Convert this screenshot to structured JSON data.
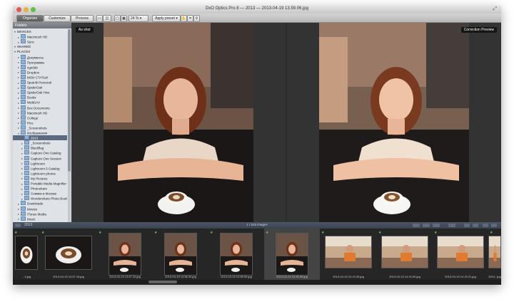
{
  "window": {
    "title": "DxO Optics Pro 8 — 2013 — 2013-04-19 13.59.06.jpg",
    "fullscreen_icon": "expand-icon"
  },
  "toolbar": {
    "tabs": [
      {
        "label": "Organize",
        "active": true
      },
      {
        "label": "Customize",
        "active": false
      },
      {
        "label": "Process",
        "active": false
      }
    ],
    "zoom_value": "24 %",
    "apply_preset_label": "Apply preset",
    "tools": [
      "hand-icon",
      "crop-icon",
      "zoom-icon"
    ]
  },
  "sidebar": {
    "header": "Folders",
    "rows": [
      {
        "label": "DEVICES",
        "type": "section"
      },
      {
        "label": "Macintosh HD",
        "type": "folder",
        "indent": 1
      },
      {
        "label": "Sync",
        "type": "folder",
        "indent": 1
      },
      {
        "label": "SHARED",
        "type": "section"
      },
      {
        "label": "PLACES",
        "type": "section"
      },
      {
        "label": "Документы",
        "type": "folder",
        "indent": 1
      },
      {
        "label": "Программы",
        "type": "folder",
        "indent": 1
      },
      {
        "label": "cgedub",
        "type": "folder",
        "indent": 1
      },
      {
        "label": "Dropbox",
        "type": "folder",
        "indent": 1
      },
      {
        "label": "МОИ СТАТЬИ",
        "type": "folder",
        "indent": 1
      },
      {
        "label": "Sputnik Personal",
        "type": "folder",
        "indent": 1
      },
      {
        "label": "SpiderOak",
        "type": "folder",
        "indent": 1
      },
      {
        "label": "SpiderOak Hive",
        "type": "folder",
        "indent": 1
      },
      {
        "label": "Books",
        "type": "folder",
        "indent": 1
      },
      {
        "label": "WebDAV",
        "type": "folder",
        "indent": 1
      },
      {
        "label": "Box Documents",
        "type": "folder",
        "indent": 1
      },
      {
        "label": "Macintosh HD",
        "type": "folder",
        "indent": 1
      },
      {
        "label": "College",
        "type": "folder",
        "indent": 1
      },
      {
        "label": "Pics",
        "type": "folder",
        "indent": 1
      },
      {
        "label": "_Screenshots",
        "type": "folder",
        "indent": 1
      },
      {
        "label": "Изображения",
        "type": "folder",
        "indent": 1,
        "selected_parent": true
      },
      {
        "label": "2013",
        "type": "folder",
        "indent": 2,
        "selected": true
      },
      {
        "label": "_Screenshots",
        "type": "folder",
        "indent": 2
      },
      {
        "label": "Blackflag",
        "type": "folder",
        "indent": 2
      },
      {
        "label": "Capture One Catalog",
        "type": "folder",
        "indent": 2
      },
      {
        "label": "Capture One Session",
        "type": "folder",
        "indent": 2
      },
      {
        "label": "Lightroom",
        "type": "folder",
        "indent": 2
      },
      {
        "label": "Lightroom 5 Catalog",
        "type": "folder",
        "indent": 2
      },
      {
        "label": "Lightroom photos",
        "type": "folder",
        "indent": 2
      },
      {
        "label": "My Pictures",
        "type": "folder",
        "indent": 2
      },
      {
        "label": "Portable Media Magnifier",
        "type": "folder",
        "indent": 2
      },
      {
        "label": "Photoshare",
        "type": "folder",
        "indent": 2
      },
      {
        "label": "Снимки в Москве",
        "type": "folder",
        "indent": 2
      },
      {
        "label": "Wondershare Photo Booth",
        "type": "folder",
        "indent": 2
      },
      {
        "label": "Downloads",
        "type": "folder",
        "indent": 1
      },
      {
        "label": "Movies",
        "type": "folder",
        "indent": 1
      },
      {
        "label": "iTunes Media",
        "type": "folder",
        "indent": 1
      },
      {
        "label": "Music",
        "type": "folder",
        "indent": 1
      }
    ]
  },
  "viewer": {
    "left_label": "As shot",
    "right_label": "Correction Preview"
  },
  "filmstrip": {
    "folder_label": "2013",
    "count_label": "1 / 615 images",
    "thumbnails": [
      {
        "caption": "...1.jpg",
        "kind": "coffee"
      },
      {
        "caption": "2013-04-19 13.57.18.jpg",
        "kind": "coffee"
      },
      {
        "caption": "2013-04-19 13.57.32.jpg",
        "kind": "portrait"
      },
      {
        "caption": "2013-04-19 13.58.30.jpg",
        "kind": "portrait"
      },
      {
        "caption": "2013-04-19 13.58.50.jpg",
        "kind": "portrait"
      },
      {
        "caption": "2013-04-19 13.59.06.jpg",
        "kind": "portrait",
        "selected": true
      },
      {
        "caption": "2013-04-19 14.13.30.jpg",
        "kind": "man"
      },
      {
        "caption": "2013-04-19 14.15.00.jpg",
        "kind": "man"
      },
      {
        "caption": "2013-04-19 14.15.21.jpg",
        "kind": "man"
      },
      {
        "caption": "2013...jpg",
        "kind": "man"
      }
    ]
  }
}
